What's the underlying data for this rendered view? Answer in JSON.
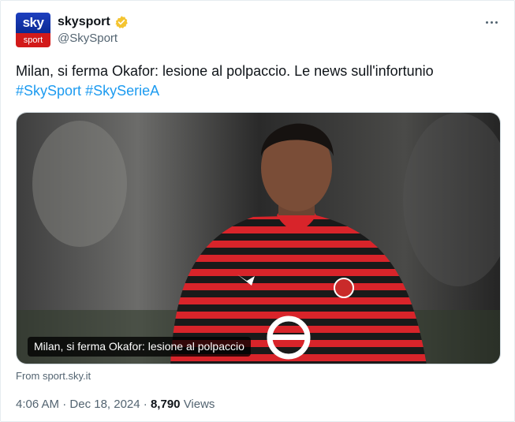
{
  "account": {
    "display_name": "skysport",
    "handle": "@SkySport",
    "avatar_top": "sky",
    "avatar_bottom": "sport",
    "verified_color": "#f4c430"
  },
  "tweet": {
    "text": "Milan, si ferma Okafor: lesione al polpaccio. Le news sull'infortunio",
    "hashtags": [
      "#SkySport",
      "#SkySerieA"
    ]
  },
  "card": {
    "caption": "Milan, si ferma Okafor: lesione al polpaccio",
    "source": "From sport.sky.it",
    "jersey_colors": {
      "red": "#d8242a",
      "black": "#151515"
    }
  },
  "meta": {
    "time": "4:06 AM",
    "date": "Dec 18, 2024",
    "separator": "·",
    "views_count": "8,790",
    "views_label": "Views"
  },
  "icons": {
    "more": "more-horizontal-icon",
    "verified": "verified-badge-icon"
  }
}
